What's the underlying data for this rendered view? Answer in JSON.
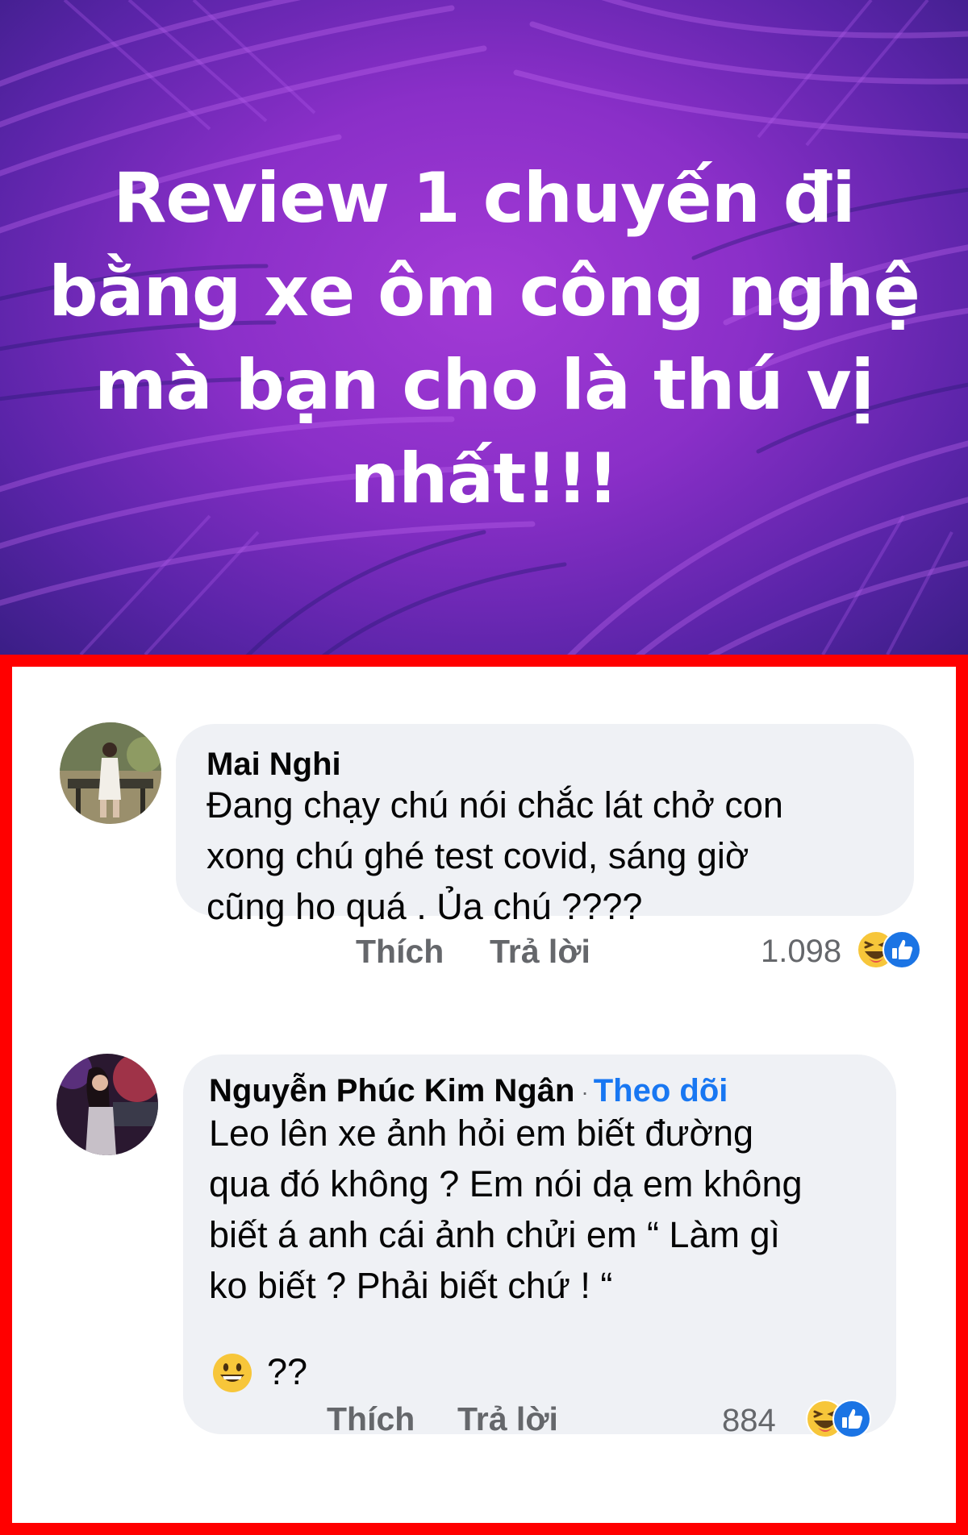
{
  "post": {
    "title_lines": [
      "Review 1 chuyến đi",
      "bằng xe ôm công nghệ",
      "mà bạn cho là thú vị",
      "nhất!!!"
    ]
  },
  "comments": [
    {
      "author": "Mai Nghi",
      "text_lines": [
        "Đang chạy chú nói chắc lát chở con",
        "xong chú ghé test covid, sáng giờ",
        "cũng ho quá . Ủa chú ????"
      ],
      "like_label": "Thích",
      "reply_label": "Trả lời",
      "reaction_count": "1.098",
      "reactions": [
        "haha-icon",
        "like-icon"
      ]
    },
    {
      "author": "Nguyễn Phúc Kim Ngân",
      "separator": "·",
      "follow_label": "Theo dõi",
      "text_lines": [
        "Leo lên xe ảnh hỏi em biết đường",
        "qua đó không ? Em nói dạ em không",
        "biết á anh cái ảnh chửi em “ Làm gì",
        "ko biết ? Phải biết chứ ! “"
      ],
      "trailing_text": "??",
      "like_label": "Thích",
      "reply_label": "Trả lời",
      "reaction_count": "884",
      "reactions": [
        "haha-icon",
        "like-icon"
      ]
    }
  ],
  "colors": {
    "banner_purple": "#8a2fc8",
    "frame_border": "#ff0000",
    "bubble_bg": "#eff1f5",
    "link_blue": "#1877f2",
    "muted_text": "#65676b"
  }
}
